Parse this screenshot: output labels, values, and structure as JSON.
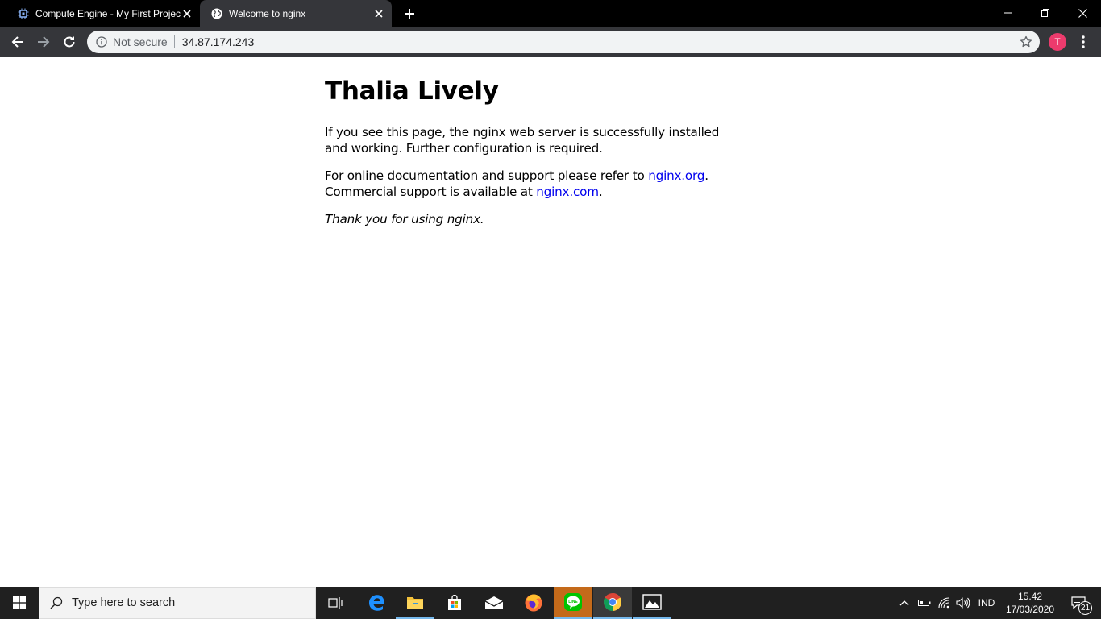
{
  "browser": {
    "tabs": [
      {
        "title": "Compute Engine - My First Project",
        "favicon": "compute-engine-icon",
        "active": false
      },
      {
        "title": "Welcome to nginx",
        "favicon": "globe-icon",
        "active": true
      }
    ],
    "omnibox": {
      "security_label": "Not secure",
      "url": "34.87.174.243"
    },
    "profile_initial": "T",
    "colors": {
      "tabstrip": "#000000",
      "toolbar": "#35363a",
      "avatar": "#ec3b6d"
    }
  },
  "page": {
    "heading": "Thalia Lively",
    "p1": "If you see this page, the nginx web server is successfully installed and working. Further configuration is required.",
    "p2_prefix": "For online documentation and support please refer to ",
    "p2_link1": "nginx.org",
    "p2_mid": ".",
    "p2_line2_prefix": "Commercial support is available at ",
    "p2_link2": "nginx.com",
    "p2_suffix": ".",
    "p3": "Thank you for using nginx.",
    "link_color": "#0000ee"
  },
  "taskbar": {
    "search_placeholder": "Type here to search",
    "apps": [
      "task-view-icon",
      "edge-icon",
      "file-explorer-icon",
      "store-icon",
      "mail-icon",
      "firefox-icon",
      "line-icon",
      "chrome-icon",
      "photos-icon"
    ],
    "tray": {
      "language": "IND",
      "time": "15.42",
      "date": "17/03/2020",
      "notification_count": "21"
    }
  }
}
